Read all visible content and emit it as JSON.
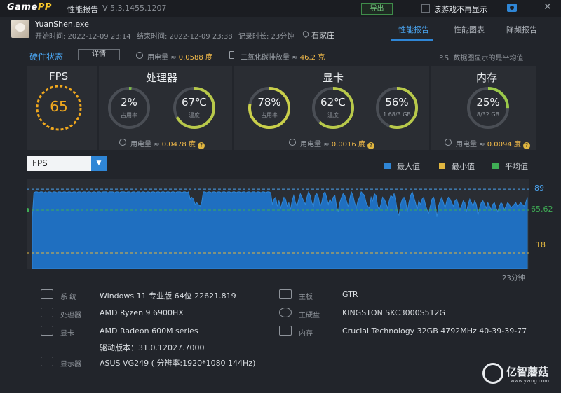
{
  "titlebar": {
    "logo_main": "Game",
    "logo_accent": "PP",
    "title": "性能报告",
    "version": "V 5.3.1455.1207",
    "export_label": "导出",
    "hide_label": "该游戏不再显示",
    "camera_icon": "camera-icon",
    "minimize": "—",
    "close": "✕"
  },
  "header": {
    "process": "YuanShen.exe",
    "start": "开始时间: 2022-12-09 23:14",
    "end": "结束时间: 2022-12-09 23:38",
    "duration": "记录时长: 23分钟",
    "location": "石家庄",
    "tabs": [
      "性能报告",
      "性能图表",
      "降频报告"
    ],
    "active_tab": 0
  },
  "status": {
    "hw_label": "硬件状态",
    "detail_label": "详情",
    "power_label": "用电量 ≈ ",
    "power_value": "0.0588 度",
    "co2_label": "二氧化碳排放量 ≈ ",
    "co2_value": "46.2 克",
    "note": "P.S. 数据图显示的是平均值"
  },
  "fps": {
    "title": "FPS",
    "value": "65"
  },
  "cpu": {
    "title": "处理器",
    "usage_value": "2%",
    "usage_label": "占用率",
    "usage_fraction": 0.02,
    "temp_value": "67℃",
    "temp_label": "温度",
    "temp_fraction": 0.67,
    "power_label": "用电量 ≈ ",
    "power_value": "0.0478 度"
  },
  "gpu": {
    "title": "显卡",
    "usage_value": "78%",
    "usage_label": "占用率",
    "usage_fraction": 0.78,
    "temp_value": "62℃",
    "temp_label": "温度",
    "temp_fraction": 0.62,
    "mem_value": "56%",
    "mem_label": "1.68/3 GB",
    "mem_fraction": 0.56,
    "power_label": "用电量 ≈ ",
    "power_value": "0.0016 度"
  },
  "ram": {
    "title": "内存",
    "usage_value": "25%",
    "usage_label": "8/32 GB",
    "usage_fraction": 0.25,
    "power_label": "用电量 ≈ ",
    "power_value": "0.0094 度"
  },
  "chart_controls": {
    "selected": "FPS",
    "legend": [
      {
        "label": "最大值",
        "color": "#2f86d6"
      },
      {
        "label": "最小值",
        "color": "#e0b640"
      },
      {
        "label": "平均值",
        "color": "#3fae55"
      }
    ]
  },
  "chart_data": {
    "type": "area",
    "series_name": "FPS",
    "max_label": "89",
    "avg_label": "65.62",
    "min_label": "18",
    "max": 89,
    "avg": 65.62,
    "min": 18,
    "ylim": [
      0,
      100
    ],
    "xlabel": "23分钟",
    "values": [
      57,
      85,
      86,
      86,
      85,
      86,
      86,
      85,
      86,
      85,
      86,
      86,
      85,
      86,
      86,
      85,
      86,
      86,
      85,
      86,
      86,
      85,
      86,
      86,
      85,
      86,
      86,
      85,
      86,
      86,
      85,
      86,
      86,
      85,
      86,
      86,
      85,
      86,
      86,
      85,
      86,
      86,
      85,
      86,
      86,
      86,
      85,
      86,
      86,
      86,
      85,
      86,
      86,
      85,
      86,
      86,
      86,
      85,
      86,
      86,
      85,
      86,
      86,
      85,
      86,
      86,
      85,
      86,
      86,
      85,
      86,
      86,
      85,
      86,
      86,
      85,
      86,
      86,
      85,
      86,
      86,
      85,
      86,
      86,
      85,
      86,
      86,
      85,
      86,
      86,
      86,
      85,
      86,
      86,
      85,
      86,
      78,
      80,
      78,
      72,
      74,
      72,
      70,
      74,
      86,
      86,
      85,
      86,
      86,
      85,
      86,
      86,
      85,
      86,
      86,
      85,
      86,
      86,
      85,
      86,
      86,
      85,
      86,
      86,
      85,
      86,
      86,
      85,
      86,
      86,
      85,
      86,
      86,
      85,
      86,
      86,
      85,
      86,
      86,
      85,
      86,
      86,
      85,
      86,
      86,
      85,
      72,
      78,
      80,
      70,
      76,
      68,
      74,
      80,
      78,
      70,
      74,
      66,
      76,
      82,
      74,
      70,
      78,
      84,
      80,
      76,
      72,
      80,
      86,
      82,
      74,
      70,
      82,
      84,
      80,
      70,
      74,
      84,
      86,
      80,
      72,
      78,
      74,
      80,
      82,
      70,
      64,
      74,
      80,
      84,
      82,
      76,
      70,
      78,
      86,
      82,
      74,
      68,
      76,
      80,
      86,
      84,
      82,
      74,
      70,
      68,
      80,
      76,
      84,
      82,
      70,
      66,
      72,
      80,
      78,
      74,
      68,
      76,
      82,
      80,
      84,
      76,
      64,
      60,
      72,
      78,
      80,
      76,
      64,
      74,
      82,
      86,
      80,
      74,
      66,
      76,
      72,
      78,
      80,
      72,
      66,
      62,
      70,
      78,
      80,
      74,
      58,
      70,
      76,
      80,
      74,
      68,
      76,
      80,
      78,
      74,
      70,
      76,
      78,
      72,
      66,
      70,
      76,
      74,
      64,
      72,
      78,
      74,
      70,
      76,
      72,
      60,
      68,
      74,
      76,
      72,
      68,
      74,
      70,
      66,
      72,
      74,
      68,
      64,
      70,
      74,
      72,
      66,
      70,
      74,
      72,
      68,
      70,
      72,
      74,
      70,
      72,
      74,
      72,
      70,
      74,
      80
    ]
  },
  "sysinfo": {
    "left": [
      {
        "icon": "windows-icon",
        "key": "系 统",
        "value": "Windows 11 专业版 64位 22621.819"
      },
      {
        "icon": "cpu-icon",
        "key": "处理器",
        "value": "AMD Ryzen 9 6900HX"
      },
      {
        "icon": "gpu-icon",
        "key": "显卡",
        "value": "AMD Radeon 600M series"
      },
      {
        "icon": "",
        "key": "",
        "value": "驱动版本：31.0.12027.7000"
      },
      {
        "icon": "monitor-icon",
        "key": "显示器",
        "value": "ASUS VG249 ( 分辨率:1920*1080 144Hz)"
      }
    ],
    "right": [
      {
        "icon": "motherboard-icon",
        "key": "主板",
        "value": "GTR"
      },
      {
        "icon": "disk-icon",
        "key": "主硬盘",
        "value": "KINGSTON SKC3000S512G"
      },
      {
        "icon": "ram-icon",
        "key": "内存",
        "value": "Crucial Technology 32GB 4792MHz 40-39-39-77"
      }
    ]
  },
  "watermark": {
    "text": "亿智蘑菇",
    "url": "www.yzmg.com"
  }
}
